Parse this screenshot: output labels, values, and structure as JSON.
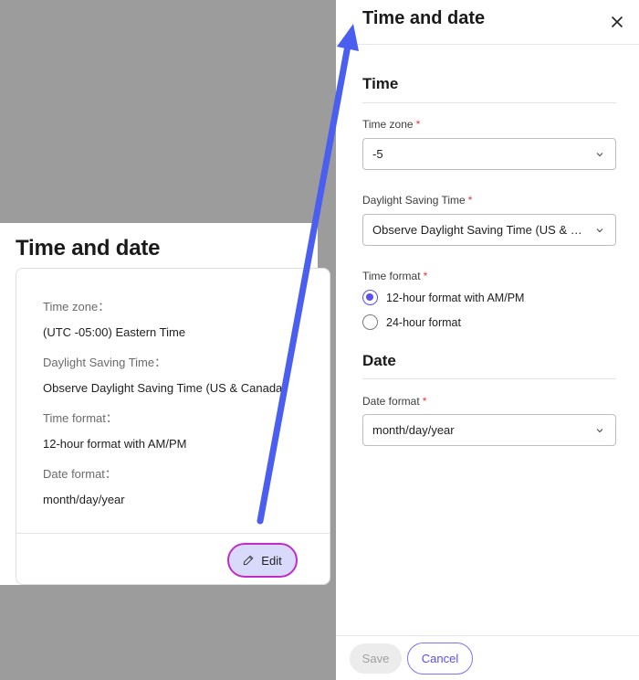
{
  "left_panel": {
    "title": "Time and date",
    "fields": [
      {
        "label": "Time zone：",
        "value": "(UTC -05:00) Eastern Time"
      },
      {
        "label": "Daylight Saving Time：",
        "value": "Observe Daylight Saving Time (US & Canada)"
      },
      {
        "label": "Time format：",
        "value": "12-hour format with AM/PM"
      },
      {
        "label": "Date format：",
        "value": "month/day/year"
      }
    ],
    "edit_label": "Edit"
  },
  "drawer": {
    "title": "Time and date",
    "close_icon": "close-icon",
    "time_section": {
      "title": "Time",
      "time_zone": {
        "label": "Time zone",
        "required": "*",
        "value": "-5"
      },
      "dst": {
        "label": "Daylight Saving Time",
        "required": "*",
        "value": "Observe Daylight Saving Time (US & Ca..."
      },
      "time_format": {
        "label": "Time format",
        "required": "*",
        "options": [
          {
            "label": "12-hour format with AM/PM",
            "selected": true
          },
          {
            "label": "24-hour format",
            "selected": false
          }
        ]
      }
    },
    "date_section": {
      "title": "Date",
      "date_format": {
        "label": "Date format",
        "required": "*",
        "value": "month/day/year"
      }
    },
    "footer": {
      "save_label": "Save",
      "cancel_label": "Cancel"
    }
  },
  "colors": {
    "accent": "#5a4ff0",
    "arrow": "#4a5ef0",
    "highlight_border": "#c02cc9",
    "required": "#d93b3b",
    "backdrop": "#9c9c9c"
  }
}
